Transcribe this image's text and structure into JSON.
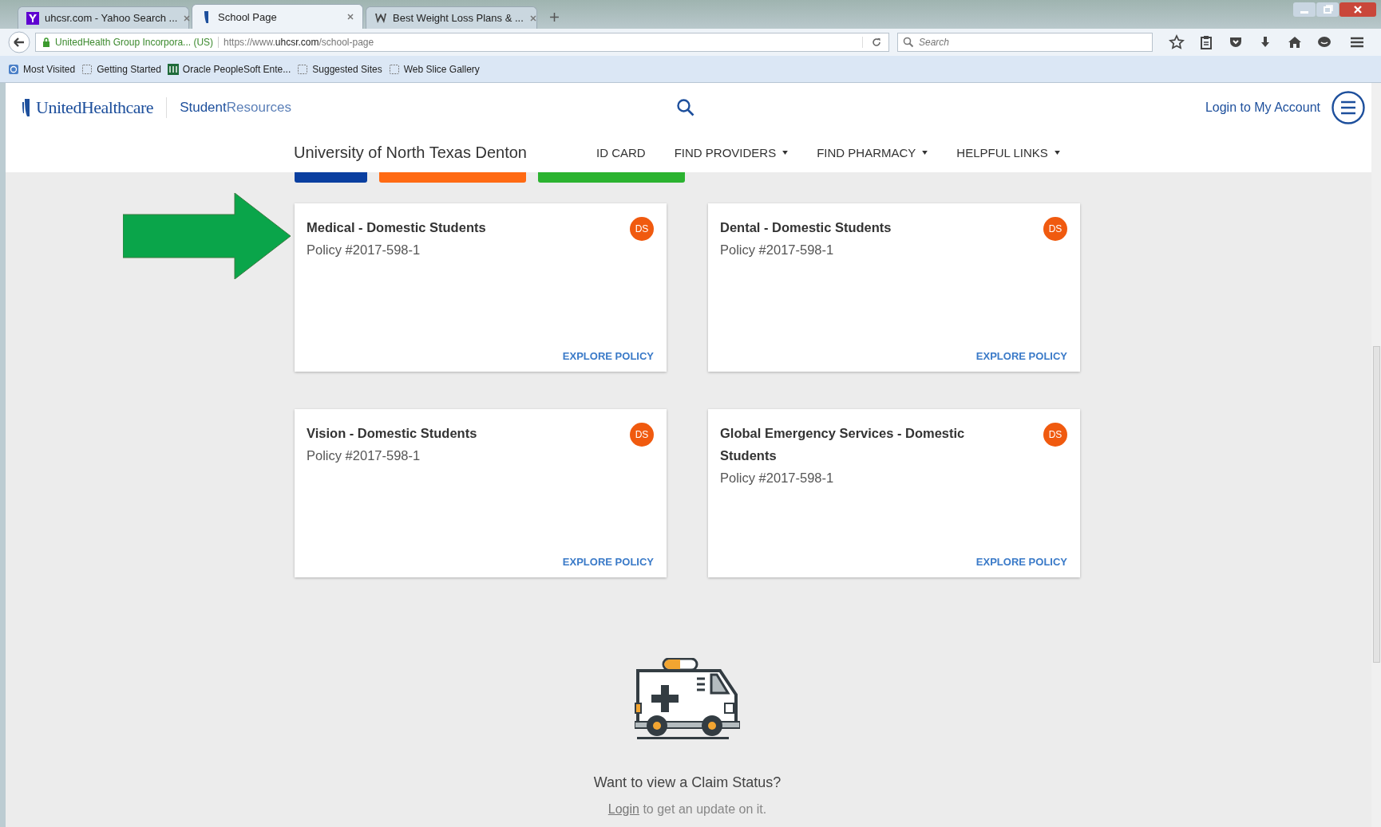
{
  "browser": {
    "tabs": [
      {
        "title": "uhcsr.com - Yahoo Search ...",
        "selected": false
      },
      {
        "title": "School Page",
        "selected": true
      },
      {
        "title": "Best Weight Loss Plans & ...",
        "selected": false
      }
    ],
    "identity": "UnitedHealth Group Incorpora... (US)",
    "url": "https://www.**uhcsr.com**/school-page",
    "search": {
      "placeholder": "Search"
    },
    "bookmarks": [
      {
        "label": "Most Visited"
      },
      {
        "label": "Getting Started"
      },
      {
        "label": "Oracle PeopleSoft Ente..."
      },
      {
        "label": "Suggested Sites"
      },
      {
        "label": "Web Slice Gallery"
      }
    ]
  },
  "header": {
    "brand": "UnitedHealthcare",
    "sub_brand_strong": "Student",
    "sub_brand": "Resources",
    "login": "Login to My Account"
  },
  "nav": {
    "school": "University of North Texas Denton",
    "items": [
      {
        "label": "ID CARD",
        "dropdown": false
      },
      {
        "label": "FIND PROVIDERS",
        "dropdown": true
      },
      {
        "label": "FIND PHARMACY",
        "dropdown": true
      },
      {
        "label": "HELPFUL LINKS",
        "dropdown": true
      }
    ]
  },
  "cards": [
    {
      "title": "Medical - Domestic Students",
      "policy": "Policy #2017-598-1",
      "badge": "DS",
      "link": "EXPLORE POLICY",
      "arrow": true
    },
    {
      "title": "Dental - Domestic Students",
      "policy": "Policy #2017-598-1",
      "badge": "DS",
      "link": "EXPLORE POLICY",
      "arrow": false
    },
    {
      "title": "Vision - Domestic Students",
      "policy": "Policy #2017-598-1",
      "badge": "DS",
      "link": "EXPLORE POLICY",
      "arrow": false
    },
    {
      "title": "Global Emergency Services - Domestic Students",
      "policy": "Policy #2017-598-1",
      "badge": "DS",
      "link": "EXPLORE POLICY",
      "arrow": false
    }
  ],
  "claim": {
    "title": "Want to view a Claim Status?",
    "login_link": "Login",
    "login_rest": "to get an update on it."
  }
}
